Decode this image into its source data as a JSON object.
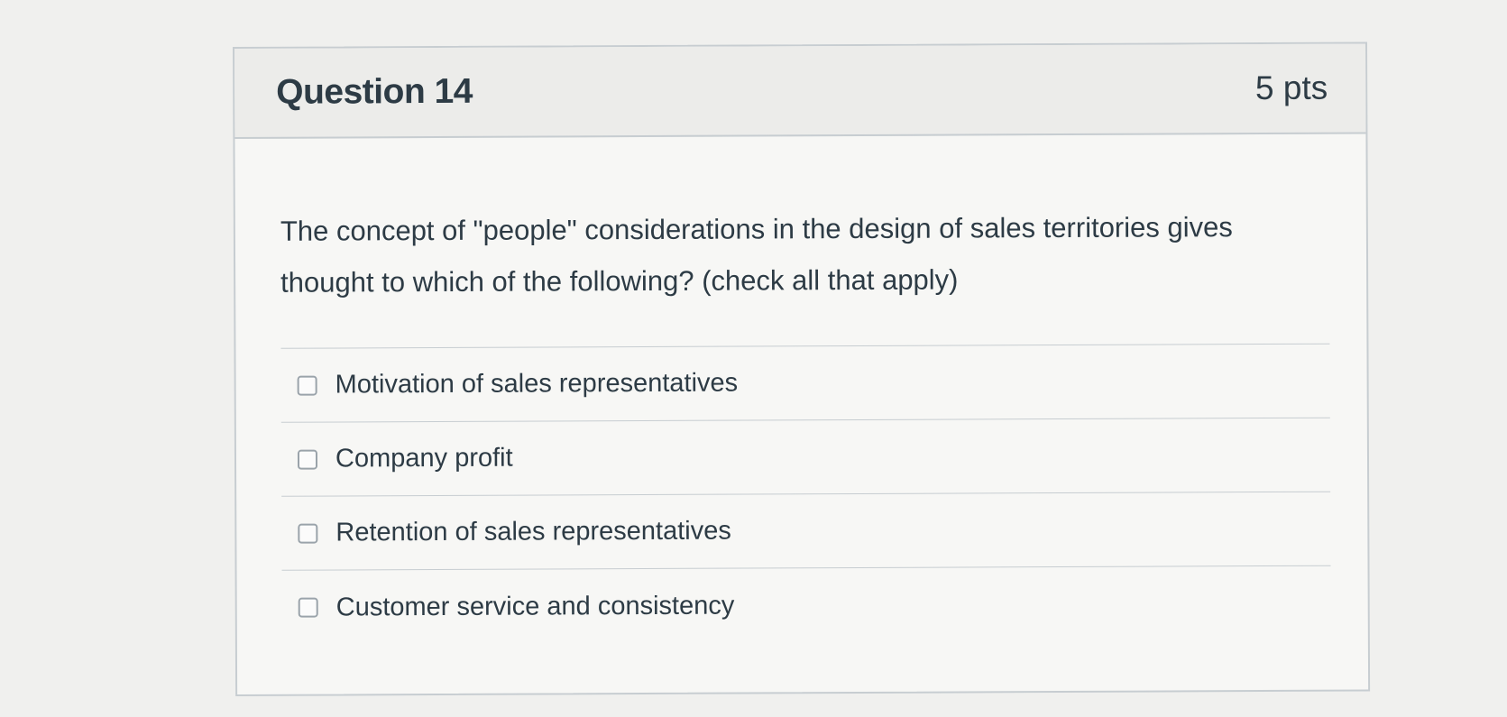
{
  "question": {
    "title": "Question 14",
    "points": "5 pts",
    "text": "The concept of \"people\" considerations in the design of sales territories gives thought to which of the following? (check all that apply)",
    "answers": [
      {
        "label": "Motivation of sales representatives",
        "checked": false
      },
      {
        "label": "Company profit",
        "checked": false
      },
      {
        "label": "Retention of sales representatives",
        "checked": false
      },
      {
        "label": "Customer service and consistency",
        "checked": false
      }
    ]
  },
  "colors": {
    "background": "#f0f0ee",
    "card_background": "#f7f7f5",
    "header_background": "#ececea",
    "border": "#c7cdd1",
    "text": "#2d3b45"
  }
}
